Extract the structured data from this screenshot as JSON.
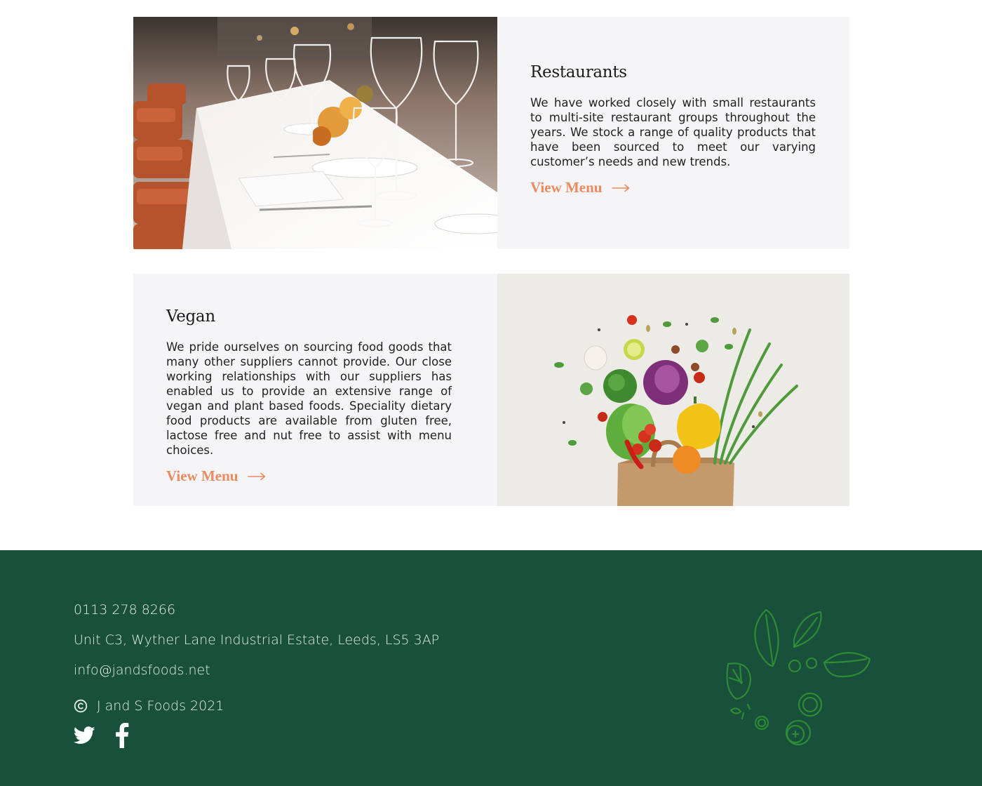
{
  "cards": {
    "restaurants": {
      "title": "Restaurants",
      "body": "We have worked closely with small restaurants to multi-site restaurant groups throughout the years. We stock a range of quality products that have been sourced to meet our varying customer’s needs and new trends.",
      "link_label": "View Menu",
      "image_icon": "restaurant-table-photo"
    },
    "vegan": {
      "title": "Vegan",
      "body": "We pride ourselves on sourcing food goods that many other suppliers cannot provide. Our close working relationships with our suppliers has enabled us to provide an extensive range of vegan and plant based foods. Speciality dietary food products are available from gluten free, lactose free and nut free to assist with menu choices.",
      "link_label": "View Menu",
      "image_icon": "vegetable-bag-photo"
    }
  },
  "footer": {
    "phone": "0113 278 8266",
    "address": "Unit C3, Wyther Lane Industrial Estate, Leeds, LS5 3AP",
    "email": "info@jandsfoods.net",
    "copyright": "J and S Foods 2021",
    "social": [
      {
        "name": "twitter-icon"
      },
      {
        "name": "facebook-icon"
      }
    ]
  },
  "colors": {
    "accent": "#ef8a5f",
    "footer_bg": "#18503c",
    "card_bg": "#f5f5f7",
    "illustration": "#2d8a35"
  }
}
